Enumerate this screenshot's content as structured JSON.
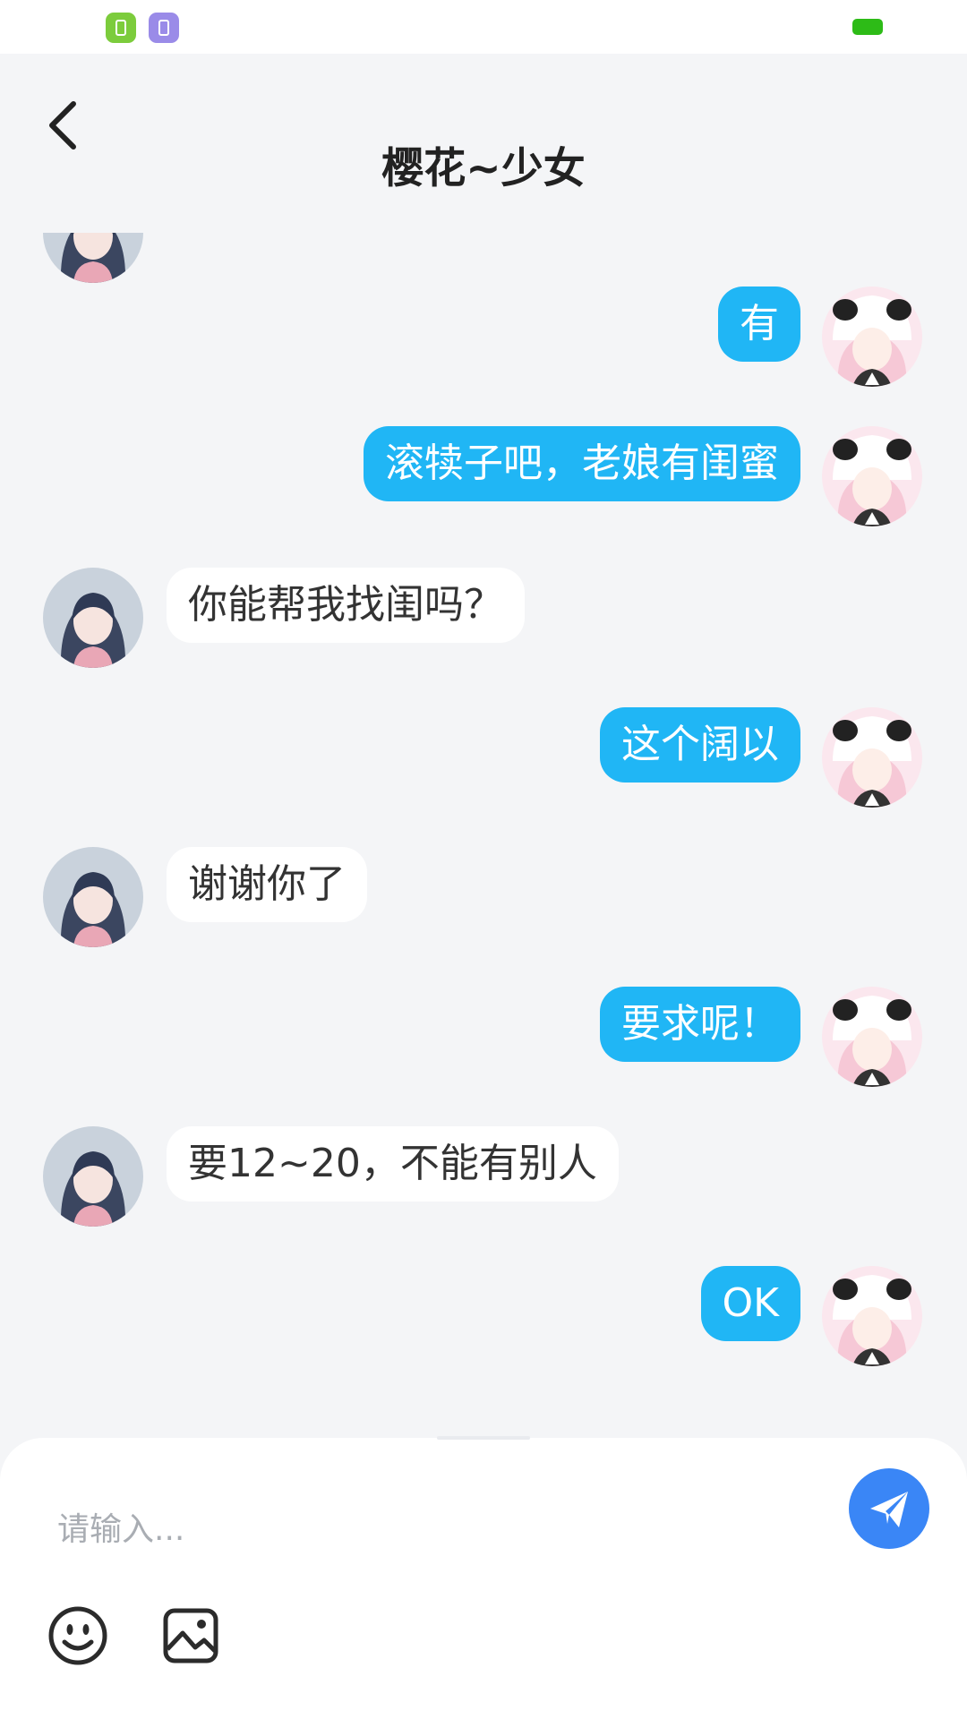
{
  "status_bar": {
    "app_icons": [
      "phone-manager-icon",
      "clipboard-app-icon"
    ],
    "battery_color": "#2dbb17"
  },
  "header": {
    "title": "樱花~少女",
    "back_icon": "chevron-left-icon"
  },
  "messages": [
    {
      "side": "right",
      "sender": "self",
      "text": "有"
    },
    {
      "side": "right",
      "sender": "self",
      "text": "滚犊子吧，老娘有闺蜜"
    },
    {
      "side": "left",
      "sender": "other",
      "text": "你能帮我找闺吗？"
    },
    {
      "side": "right",
      "sender": "self",
      "text": "这个阔以"
    },
    {
      "side": "left",
      "sender": "other",
      "text": "谢谢你了"
    },
    {
      "side": "right",
      "sender": "self",
      "text": "要求呢！"
    },
    {
      "side": "left",
      "sender": "other",
      "text": "要12~20，不能有别人"
    },
    {
      "side": "right",
      "sender": "self",
      "text": "OK"
    }
  ],
  "composer": {
    "placeholder": "请输入...",
    "value": "",
    "send_icon": "paper-plane-icon",
    "emoji_icon": "smiley-icon",
    "image_icon": "image-icon"
  },
  "colors": {
    "self_bubble": "#20b6f5",
    "other_bubble": "#ffffff",
    "send_button": "#3a86f6",
    "background": "#f4f5f7"
  }
}
